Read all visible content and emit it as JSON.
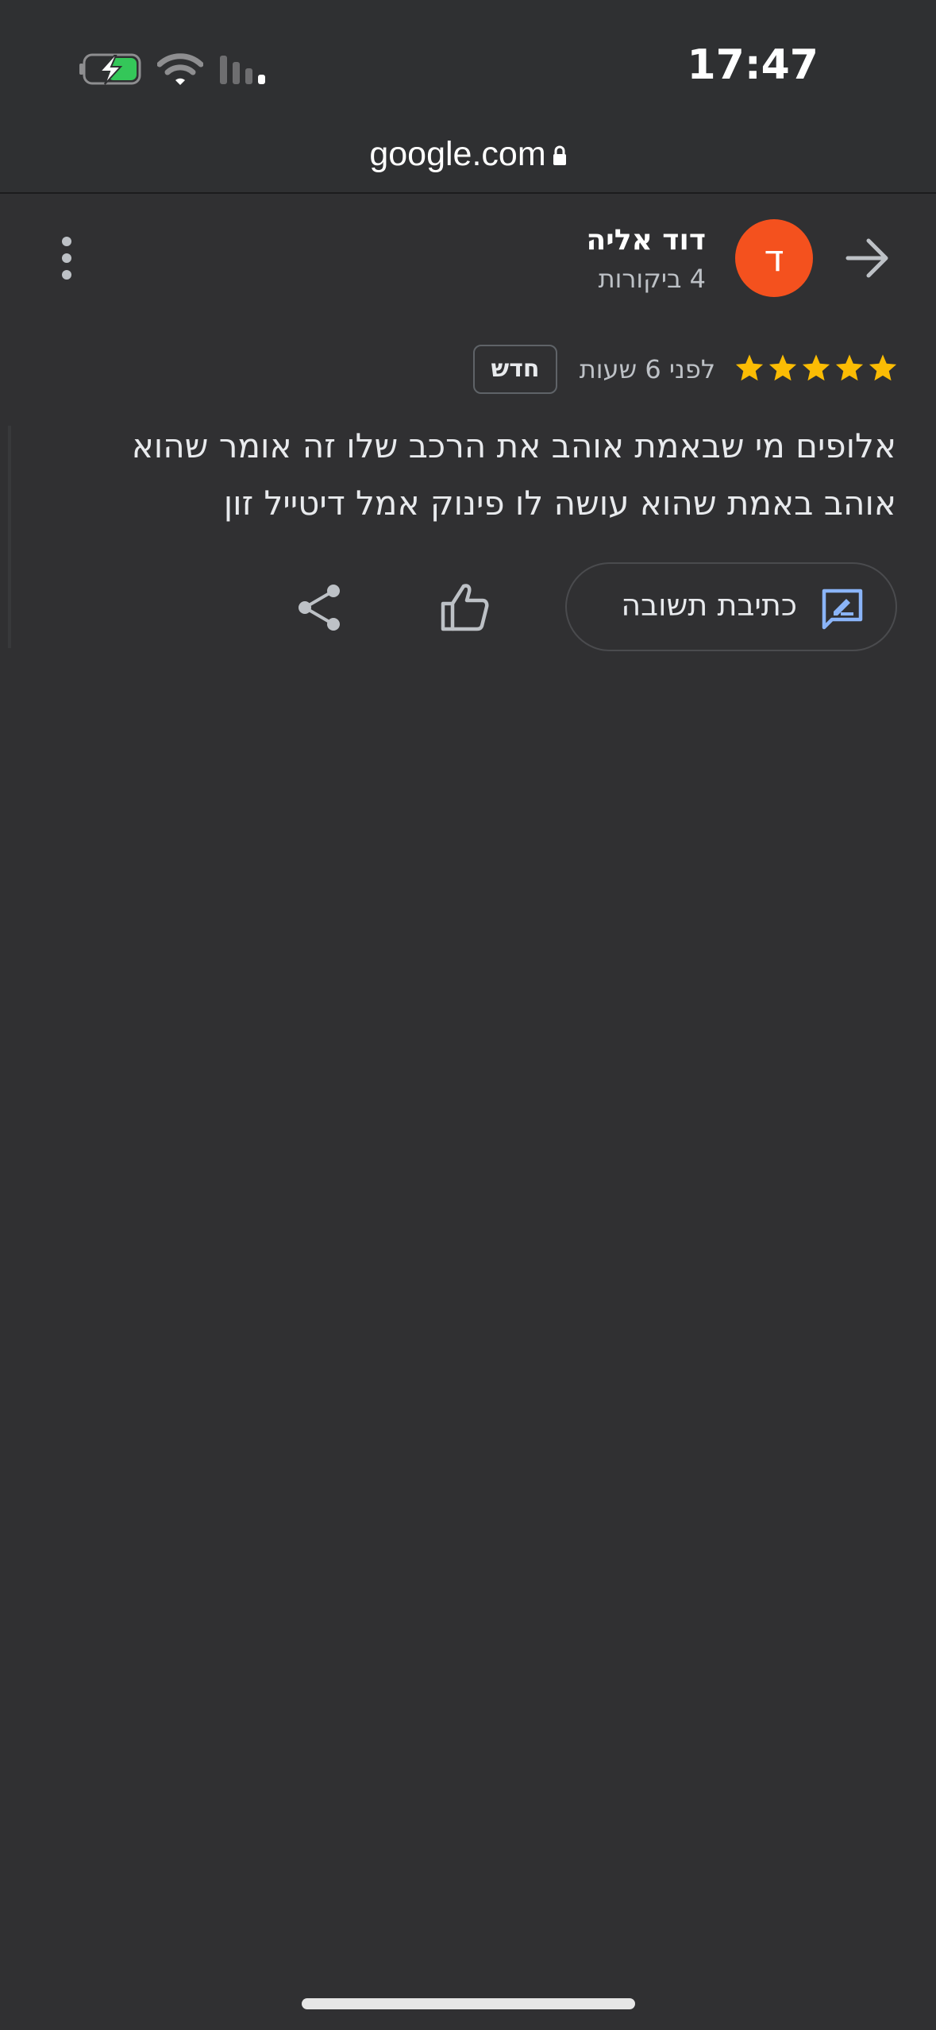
{
  "status_bar": {
    "time": "17:47",
    "battery_icon": "battery-charging-icon",
    "wifi_icon": "wifi-icon",
    "signal_icon": "cellular-signal-icon"
  },
  "browser": {
    "url": "google.com",
    "lock_icon": "lock-icon"
  },
  "review": {
    "author": {
      "name": "דוד אליה",
      "review_count": "4 ביקורות",
      "avatar_letter": "ד",
      "avatar_color": "#f4511e"
    },
    "rating": 5,
    "rating_max": 5,
    "star_color": "#fbbc04",
    "time": "לפני 6 שעות",
    "badge": "חדש",
    "text": "אלופים מי שבאמת אוהב את הרכב שלו זה אומר שהוא אוהב באמת שהוא עושה לו פינוק אמל דיטייל זון"
  },
  "actions": {
    "reply_label": "כתיבת תשובה",
    "reply_icon": "rate-review-icon",
    "like_icon": "thumb-up-icon",
    "share_icon": "share-icon"
  },
  "header": {
    "back_icon": "arrow-forward-icon",
    "more_icon": "more-vertical-icon"
  },
  "colors": {
    "background": "#303032",
    "accent_blue": "#8ab4f8"
  }
}
